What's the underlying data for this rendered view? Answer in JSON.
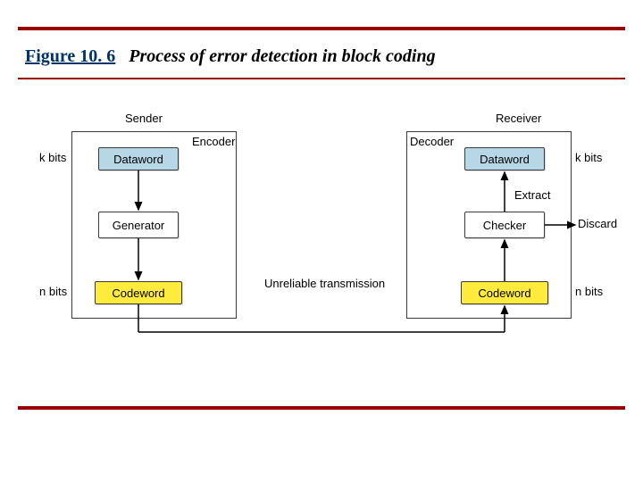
{
  "figure": {
    "number": "Figure 10. 6",
    "caption": "Process of error detection in block coding"
  },
  "sender": {
    "title": "Sender",
    "subtitle": "Encoder",
    "dataword": "Dataword",
    "generator": "Generator",
    "codeword": "Codeword",
    "kbits": "k bits",
    "nbits": "n bits"
  },
  "receiver": {
    "title": "Receiver",
    "subtitle": "Decoder",
    "dataword": "Dataword",
    "checker": "Checker",
    "codeword": "Codeword",
    "kbits": "k bits",
    "nbits": "n bits",
    "extract": "Extract",
    "discard": "Discard"
  },
  "link": {
    "label": "Unreliable transmission"
  }
}
